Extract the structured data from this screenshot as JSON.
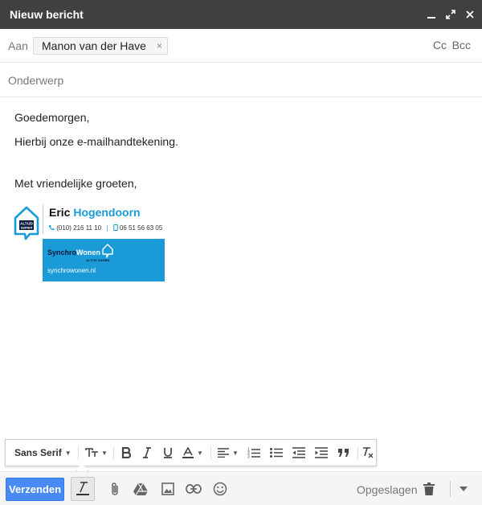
{
  "window": {
    "title": "Nieuw bericht"
  },
  "recipients": {
    "to_label": "Aan",
    "chips": [
      {
        "name": "Manon van der Have",
        "remove": "×"
      }
    ],
    "cc_label": "Cc",
    "bcc_label": "Bcc"
  },
  "subject": {
    "placeholder": "Onderwerp",
    "value": ""
  },
  "message": {
    "lines": [
      "Goedemorgen,",
      "Hierbij onze e-mailhandtekening.",
      "Met vriendelijke groeten,"
    ]
  },
  "signature": {
    "logo_text_top": "ALTIJD",
    "logo_text_bottom": "samen",
    "first_name": "Eric",
    "last_name": "Hogendoorn",
    "phone": "(010) 216 11 10",
    "separator": "|",
    "mobile": "06 51 56 63 05",
    "brand_part1": "Synchro",
    "brand_part2": "Wonen",
    "brand_tagline": "ALTIJD SAMEN",
    "website": "synchrowonen.nl",
    "colors": {
      "accent": "#1a9ad7",
      "dark": "#0c1d3b"
    }
  },
  "format_toolbar": {
    "font": "Sans Serif",
    "icons": [
      "text-size-icon",
      "bold-icon",
      "italic-icon",
      "underline-icon",
      "text-color-icon",
      "align-icon",
      "numbered-list-icon",
      "bulleted-list-icon",
      "indent-less-icon",
      "indent-more-icon",
      "quote-icon",
      "clear-formatting-icon"
    ]
  },
  "bottom_bar": {
    "send_label": "Verzenden",
    "saved_label": "Opgeslagen",
    "icons": [
      "formatting-icon",
      "attach-icon",
      "drive-icon",
      "photo-icon",
      "link-icon",
      "emoji-icon",
      "trash-icon",
      "more-options-icon"
    ],
    "colors": {
      "send": "#4a8af4"
    }
  }
}
